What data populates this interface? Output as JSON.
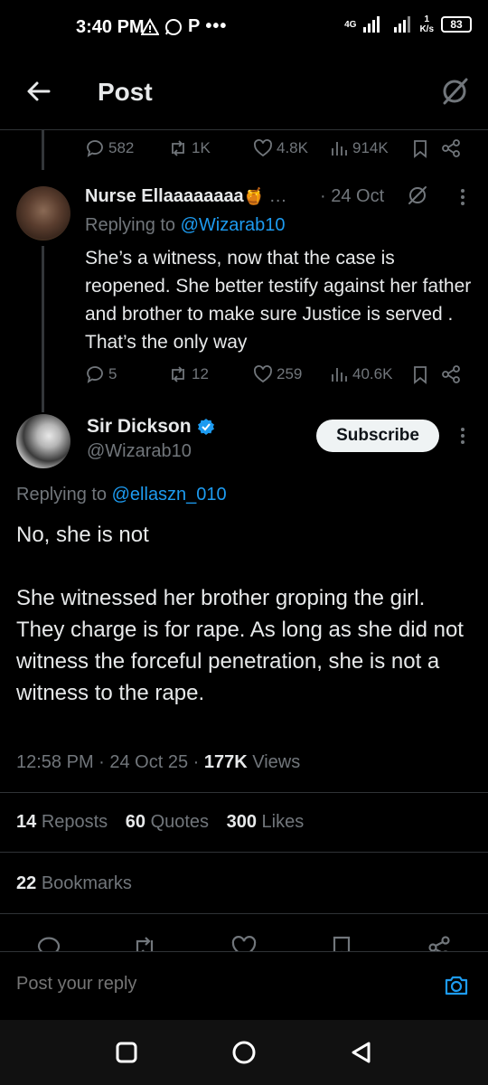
{
  "status_bar": {
    "time": "3:40 PM",
    "network": "4G",
    "speed_value": "1",
    "speed_unit": "K/s",
    "battery": "83"
  },
  "header": {
    "title": "Post"
  },
  "parent_tweet_actions": {
    "replies": "582",
    "reposts": "1K",
    "likes": "4.8K",
    "views": "914K"
  },
  "reply_tweet": {
    "author": "Nurse Ellaaaaaaaa",
    "author_emoji": "🍯",
    "ellipsis": "…",
    "date": "· 24 Oct",
    "replying_prefix": "Replying to ",
    "replying_to": "@Wizarab10",
    "text": "She’s a witness, now that the case is reopened. She better testify against her father and brother to make sure Justice is served . That’s the only way",
    "replies": "5",
    "reposts": "12",
    "likes": "259",
    "views": "40.6K"
  },
  "main_tweet": {
    "author": "Sir Dickson",
    "handle": "@Wizarab10",
    "subscribe_label": "Subscribe",
    "replying_prefix": "Replying to ",
    "replying_to": "@ellaszn_010",
    "text": "No, she is not\n\nShe witnessed her brother groping the girl. They charge is for rape. As long as she did not witness the forceful penetration, she is not a witness to the rape.",
    "time": "12:58 PM · 24 Oct 25 · ",
    "views_count": "177K",
    "views_label": " Views",
    "reposts_count": "14",
    "reposts_label": "Reposts",
    "quotes_count": "60",
    "quotes_label": "Quotes",
    "likes_count": "300",
    "likes_label": "Likes",
    "bookmarks_count": "22",
    "bookmarks_label": "Bookmarks"
  },
  "reply_bar": {
    "placeholder": "Post your reply"
  },
  "colors": {
    "accent": "#1d9bf0",
    "muted": "#71767b",
    "text": "#e7e9ea",
    "background": "#000000"
  }
}
